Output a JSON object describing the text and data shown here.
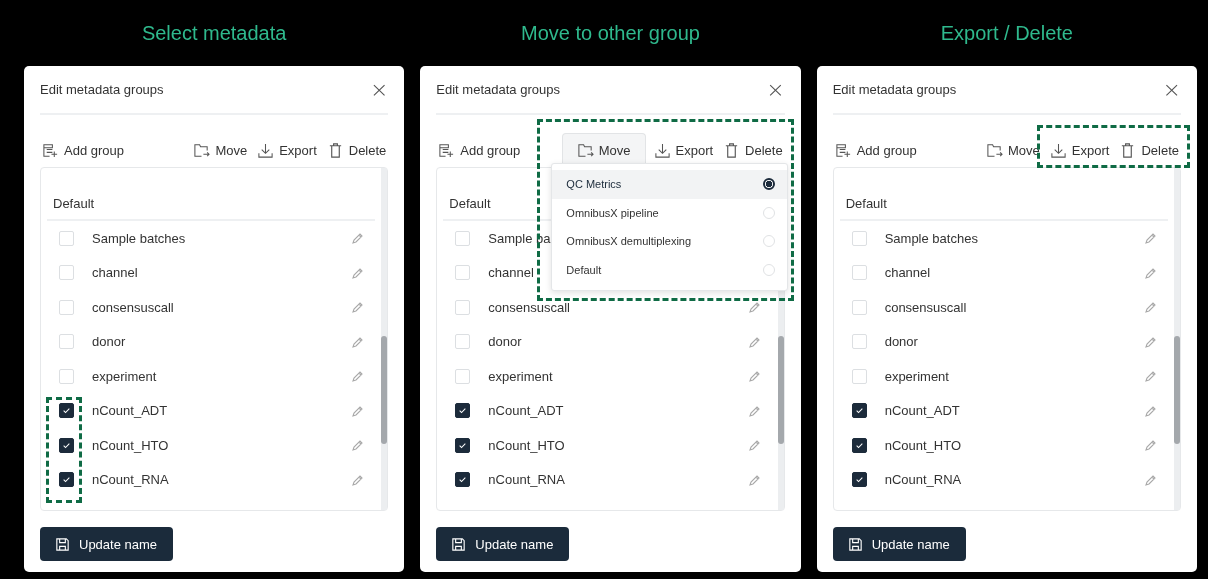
{
  "panels": [
    {
      "heading": "Select metadata",
      "kind": "checked-boxes",
      "dialog_title": "Edit metadata groups",
      "close": "×",
      "add_group": "Add group",
      "actions": [
        {
          "kind": "move",
          "label": "Move",
          "active": false
        },
        {
          "kind": "export",
          "label": "Export",
          "active": false
        },
        {
          "kind": "delete",
          "label": "Delete",
          "active": false
        }
      ],
      "group": "Default",
      "items": [
        {
          "label": "Sample batches",
          "checked": false
        },
        {
          "label": "channel",
          "checked": false
        },
        {
          "label": "consensuscall",
          "checked": false
        },
        {
          "label": "donor",
          "checked": false
        },
        {
          "label": "experiment",
          "checked": false
        },
        {
          "label": "nCount_ADT",
          "checked": true
        },
        {
          "label": "nCount_HTO",
          "checked": true
        },
        {
          "label": "nCount_RNA",
          "checked": true
        }
      ],
      "button": "Update name"
    },
    {
      "heading": "Move to other group",
      "kind": "move-menu",
      "dialog_title": "Edit metadata groups",
      "close": "×",
      "add_group": "Add group",
      "actions": [
        {
          "kind": "move",
          "label": "Move",
          "active": true
        },
        {
          "kind": "export",
          "label": "Export",
          "active": false
        },
        {
          "kind": "delete",
          "label": "Delete",
          "active": false
        }
      ],
      "menu": [
        {
          "label": "QC Metrics",
          "selected": true
        },
        {
          "label": "OmnibusX pipeline",
          "selected": false
        },
        {
          "label": "OmnibusX demultiplexing",
          "selected": false
        },
        {
          "label": "Default",
          "selected": false
        }
      ],
      "group": "Default",
      "items": [
        {
          "label": "Sample ba",
          "checked": false
        },
        {
          "label": "channel",
          "checked": false
        },
        {
          "label": "consensuscall",
          "checked": false
        },
        {
          "label": "donor",
          "checked": false
        },
        {
          "label": "experiment",
          "checked": false
        },
        {
          "label": "nCount_ADT",
          "checked": true
        },
        {
          "label": "nCount_HTO",
          "checked": true
        },
        {
          "label": "nCount_RNA",
          "checked": true
        }
      ],
      "button": "Update name"
    },
    {
      "heading": "Export / Delete",
      "kind": "export-delete",
      "dialog_title": "Edit metadata groups",
      "close": "×",
      "add_group": "Add group",
      "actions": [
        {
          "kind": "move",
          "label": "Move",
          "active": false
        },
        {
          "kind": "export",
          "label": "Export",
          "active": false
        },
        {
          "kind": "delete",
          "label": "Delete",
          "active": false
        }
      ],
      "group": "Default",
      "items": [
        {
          "label": "Sample batches",
          "checked": false
        },
        {
          "label": "channel",
          "checked": false
        },
        {
          "label": "consensuscall",
          "checked": false
        },
        {
          "label": "donor",
          "checked": false
        },
        {
          "label": "experiment",
          "checked": false
        },
        {
          "label": "nCount_ADT",
          "checked": true
        },
        {
          "label": "nCount_HTO",
          "checked": true
        },
        {
          "label": "nCount_RNA",
          "checked": true
        }
      ],
      "button": "Update name"
    }
  ]
}
